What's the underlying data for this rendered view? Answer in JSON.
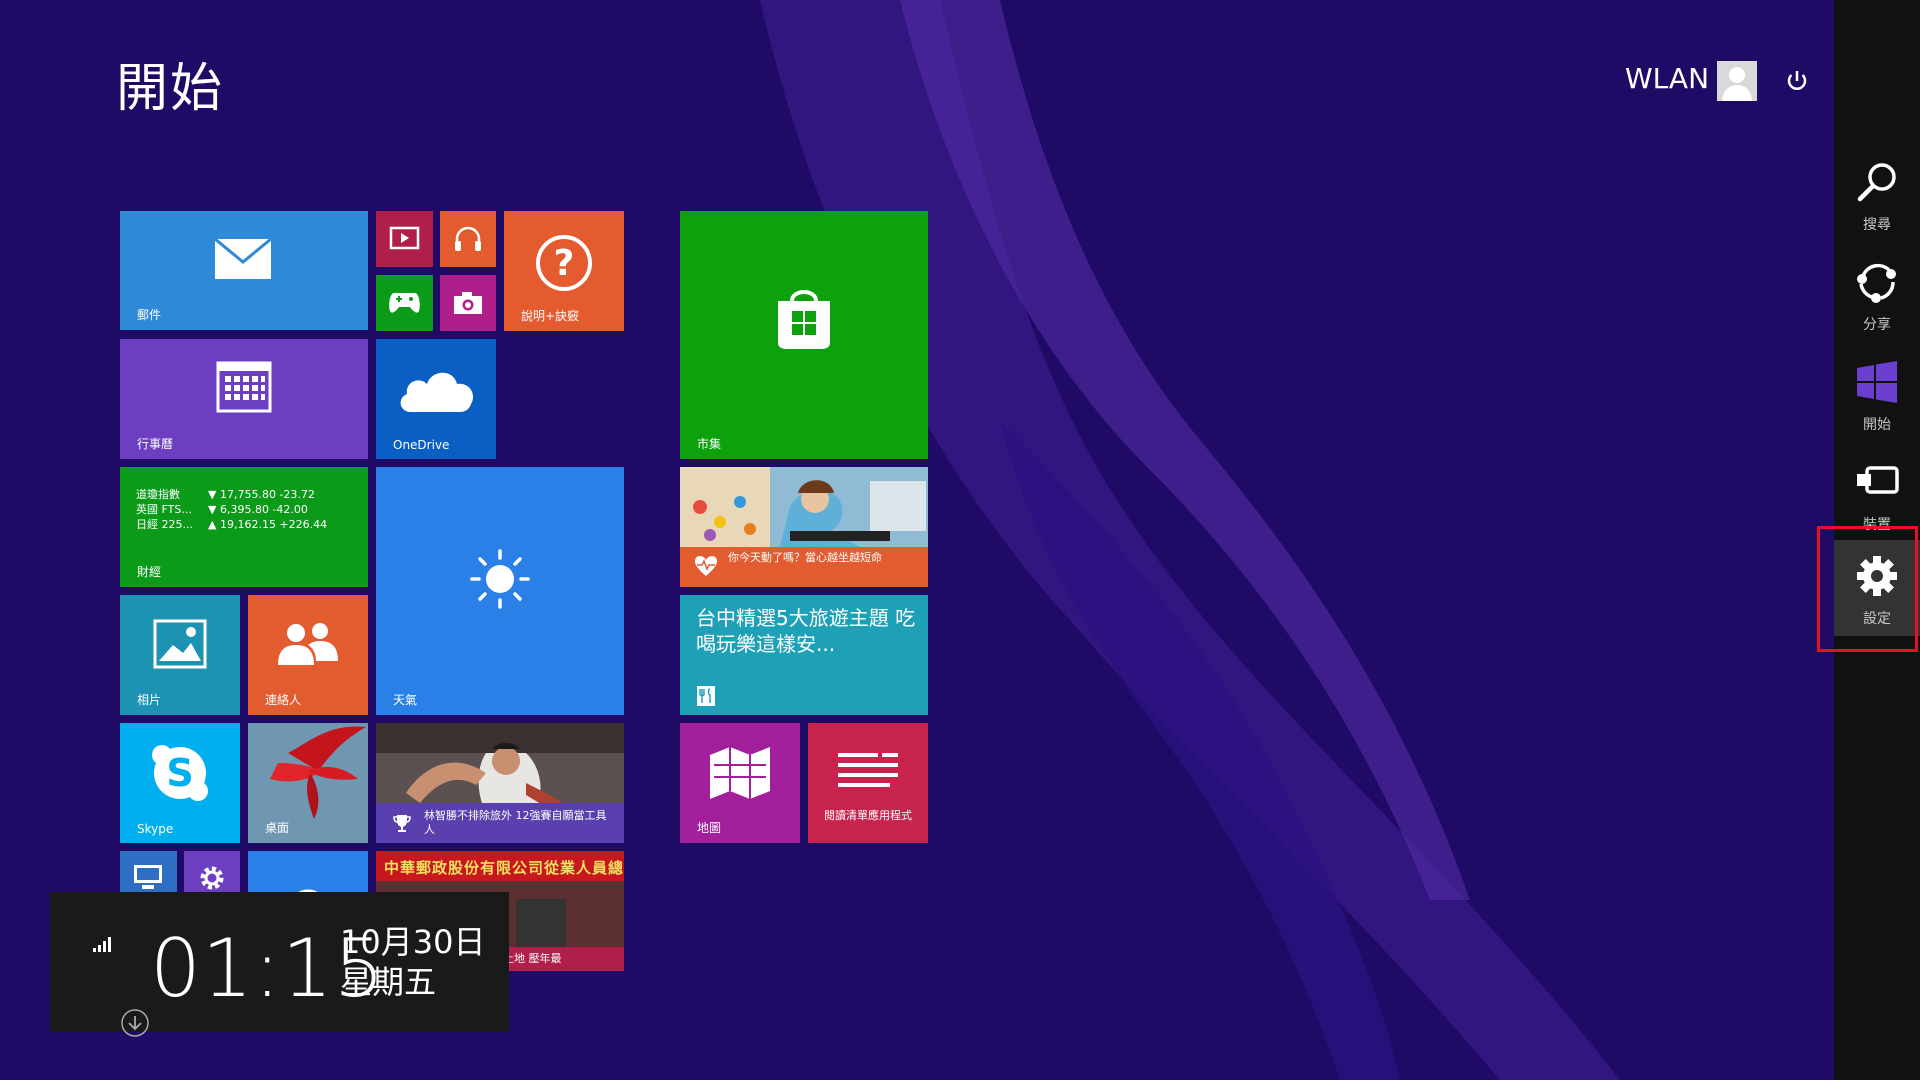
{
  "header": {
    "title": "開始",
    "user_name": "WLAN"
  },
  "tiles": {
    "mail": "郵件",
    "help": "說明+訣竅",
    "calendar": "行事曆",
    "onedrive": "OneDrive",
    "finance": {
      "label": "財經",
      "quotes": [
        {
          "name": "道瓊指數",
          "value": "▼ 17,755.80 -23.72"
        },
        {
          "name": "英國 FTS...",
          "value": "▼ 6,395.80 -42.00"
        },
        {
          "name": "日經 225...",
          "value": "▲ 19,162.15 +226.44"
        }
      ]
    },
    "weather": "天氣",
    "photos": "相片",
    "people": "連絡人",
    "store": "市集",
    "health": "你今天動了嗎？當心越坐越短命",
    "food": "台中精選5大旅遊主題 吃喝玩樂這樣安...",
    "skype": "Skype",
    "desktop": "桌面",
    "sports": "林智勝不排除旅外 12強賽自願當工具人",
    "maps": "地圖",
    "reading_list": "閱讀清單應用程式",
    "news_sign": "中華郵政股份有限公司從業人員總統",
    "news_caption": "專搶土地 壓年最"
  },
  "charms": [
    {
      "label": "搜尋",
      "icon": "search-icon"
    },
    {
      "label": "分享",
      "icon": "share-icon"
    },
    {
      "label": "開始",
      "icon": "windows-icon"
    },
    {
      "label": "裝置",
      "icon": "devices-icon"
    },
    {
      "label": "設定",
      "icon": "settings-icon",
      "selected": true
    }
  ],
  "clock": {
    "time": "01:15",
    "date": "10月30日",
    "weekday": "星期五"
  },
  "colors": {
    "background": "#1f0a66",
    "mail": "#2e8ad8",
    "help": "#e35b2f",
    "calendar": "#6b3fc0",
    "onedrive": "#0a5ec4",
    "finance": "#0b9b19",
    "weather": "#2b80e8",
    "photos": "#1d93b4",
    "people": "#e25c30",
    "store": "#0ea10e",
    "food": "#1ea1b6",
    "skype": "#00aff0",
    "maps": "#a3209d",
    "reading_list": "#c7234d",
    "highlight": "#e81123"
  }
}
